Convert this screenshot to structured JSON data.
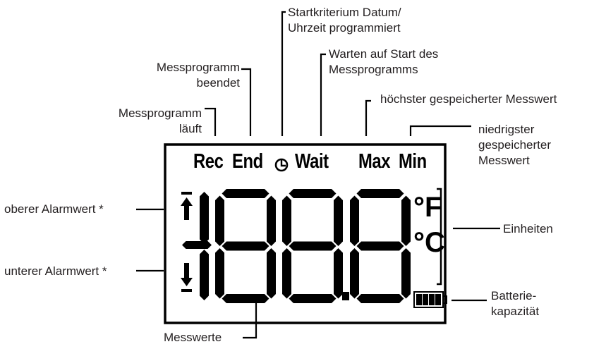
{
  "annotations": {
    "start_criterion": [
      "Startkriterium Datum/",
      "Uhrzeit programmiert"
    ],
    "program_ended": [
      "Messprogramm",
      "beendet"
    ],
    "waiting_for_start": [
      "Warten auf Start des",
      "Messprogramms"
    ],
    "max_value": "höchster gespeicherter Messwert",
    "program_running": [
      "Messprogramm",
      "läuft"
    ],
    "min_value": [
      "niedrigster",
      "gespeicherter",
      "Messwert"
    ],
    "upper_alarm": "oberer Alarmwert *",
    "lower_alarm": "unterer Alarmwert *",
    "units": "Einheiten",
    "battery": [
      "Batterie-",
      "kapazität"
    ],
    "readings": "Messwerte"
  },
  "display": {
    "rec": "Rec",
    "end": "End",
    "wait": "Wait",
    "max": "Max",
    "min": "Min",
    "fahrenheit": "°F",
    "celsius": "°C",
    "digits": "188.8",
    "clock_icon": "clock-icon",
    "arrow_up_icon": "arrow-up-icon",
    "arrow_down_icon": "arrow-down-icon",
    "battery_icon": "battery-icon",
    "battery_level": 1.0
  }
}
